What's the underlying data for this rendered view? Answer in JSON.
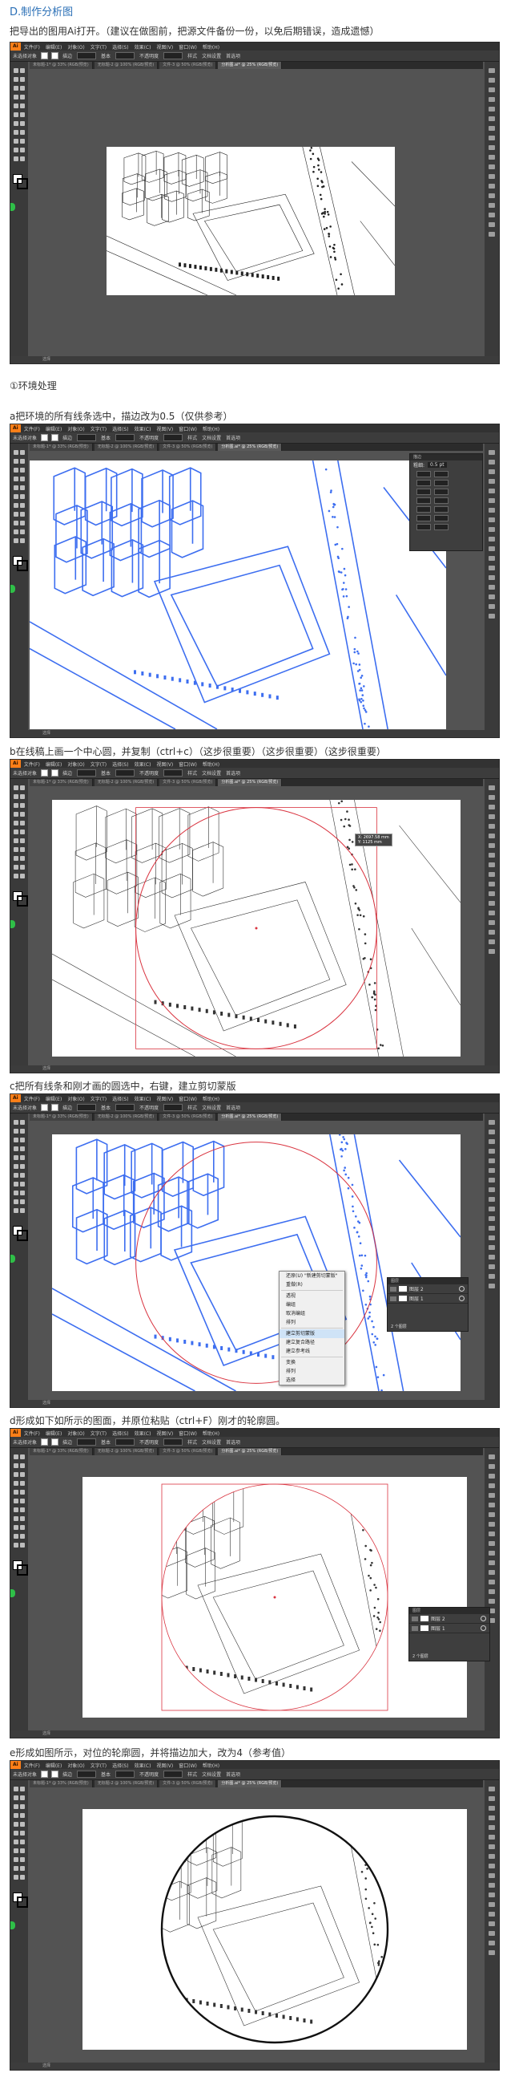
{
  "captions": [
    "D.制作分析图",
    "把导出的图用Ai打开。（建议在做图前，把源文件备份一份，以免后期错误，造成遗憾）",
    "①环境处理",
    "a把环境的所有线条选中，描边改为0.5（仅供参考）",
    "b在线稿上画一个中心圆，并复制（ctrl+c）（这步很重要）（这步很重要）（这步很重要）",
    "c把所有线条和刚才画的圆选中，右键，建立剪切蒙版",
    "d形成如下如所示的图面，并原位粘贴（ctrl+F）刚才的轮廓圆。",
    "e形成如图所示，对位的轮廓圆，并将描边加大，改为4（参考值）"
  ],
  "app": {
    "logo": "Ai",
    "menus": [
      "文件(F)",
      "编辑(E)",
      "对象(O)",
      "文字(T)",
      "选择(S)",
      "效果(C)",
      "视图(V)",
      "窗口(W)",
      "帮助(H)"
    ],
    "control_bar": [
      "未选择对象",
      "描边",
      "基本",
      "不透明度",
      "样式",
      "文档设置",
      "首选项"
    ],
    "tabs": [
      "未标题-1* @ 33% (RGB/预览)",
      "无标题-2 @ 100% (RGB/预览)",
      "文件-3 @ 50% (RGB/预览)",
      "分析图.ai* @ 25% (RGB/预览)"
    ],
    "status": "选择"
  },
  "context_menu": {
    "items": [
      "还原(U) \"新建剪切蒙版\"",
      "重做(R)",
      "透视",
      "编组",
      "取消编组",
      "排列",
      "建立剪切蒙版",
      "建立复合路径",
      "建立参考线",
      "变换",
      "排列",
      "选择"
    ],
    "highlight_index": 6
  },
  "layers_panel": {
    "title": "图层",
    "rows": [
      "图层 2",
      "图层 1"
    ],
    "footer": "2 个图层"
  },
  "stroke_panel": {
    "title": "描边",
    "weight_label": "粗细:",
    "weight_value": "0.5 pt"
  },
  "tooltip": "X: 2697.58 mm\nY: 1125 mm",
  "colors": {
    "caption_blue": "#2a6fb6",
    "selection_blue": "#3d6ef0",
    "circle_red": "#d9333f",
    "canvas_gray": "#535353",
    "panel_dark": "#3c3c3c",
    "ai_orange": "#ff7f18"
  }
}
